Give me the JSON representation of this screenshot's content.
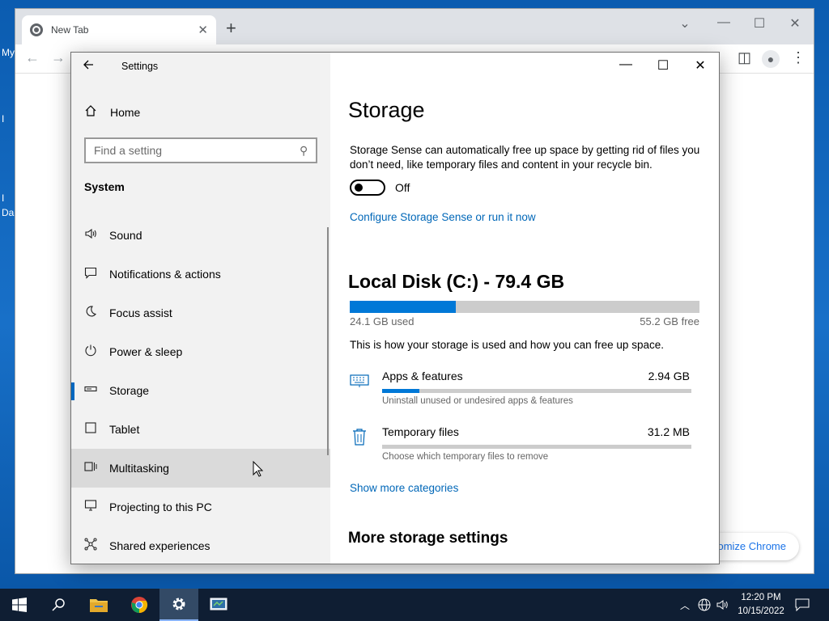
{
  "desktop": {
    "labels": [
      "My",
      "I",
      "I",
      "Da"
    ]
  },
  "chrome": {
    "tab_title": "New Tab",
    "new_tab_symbol": "+",
    "customize_label": "Customize Chrome"
  },
  "settings": {
    "window_title": "Settings",
    "home_label": "Home",
    "search_placeholder": "Find a setting",
    "section_heading": "System",
    "nav": [
      {
        "label": "Sound",
        "icon": "speaker-icon"
      },
      {
        "label": "Notifications & actions",
        "icon": "notification-icon"
      },
      {
        "label": "Focus assist",
        "icon": "moon-icon"
      },
      {
        "label": "Power & sleep",
        "icon": "power-icon"
      },
      {
        "label": "Storage",
        "icon": "storage-icon"
      },
      {
        "label": "Tablet",
        "icon": "tablet-icon"
      },
      {
        "label": "Multitasking",
        "icon": "multitasking-icon"
      },
      {
        "label": "Projecting to this PC",
        "icon": "projecting-icon"
      },
      {
        "label": "Shared experiences",
        "icon": "shared-experiences-icon"
      }
    ],
    "selected_nav": "Storage",
    "hovered_nav": "Multitasking"
  },
  "storage": {
    "heading": "Storage",
    "description": "Storage Sense can automatically free up space by getting rid of files you don’t need, like temporary files and content in your recycle bin.",
    "toggle_state": "Off",
    "configure_link": "Configure Storage Sense or run it now",
    "disk_title": "Local Disk (C:) - 79.4 GB",
    "disk_used": "24.1 GB used",
    "disk_free": "55.2 GB free",
    "disk_used_fraction": 0.304,
    "how_text": "This is how your storage is used and how you can free up space.",
    "categories": [
      {
        "name": "Apps & features",
        "size": "2.94 GB",
        "desc": "Uninstall unused or undesired apps & features",
        "fill": 0.12,
        "icon": "keyboard-icon"
      },
      {
        "name": "Temporary files",
        "size": "31.2 MB",
        "desc": "Choose which temporary files to remove",
        "fill": 0.0,
        "icon": "trash-icon"
      }
    ],
    "show_more_link": "Show more categories",
    "more_heading": "More storage settings"
  },
  "taskbar": {
    "clock_time": "12:20 PM",
    "clock_date": "10/15/2022"
  },
  "colors": {
    "accent": "#0078d7",
    "link": "#0067b8",
    "taskbar": "#0f1e33",
    "desktop": "#0b5cb0"
  }
}
